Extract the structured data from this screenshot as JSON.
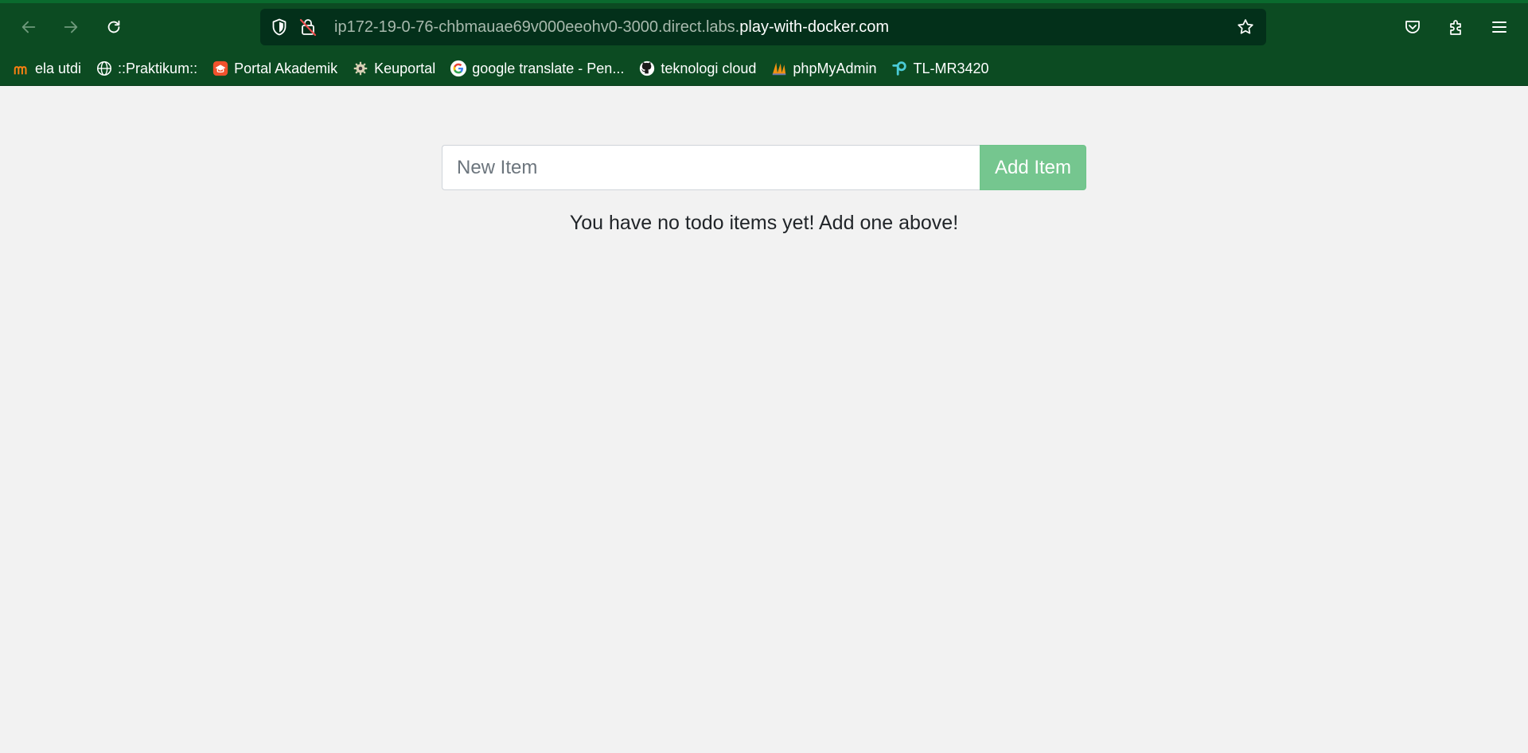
{
  "browser": {
    "url_prefix": "ip172-19-0-76-chbmauae69v000eeohv0-3000.direct.labs.",
    "url_host": "play-with-docker.com",
    "colors": {
      "chrome": "#0c4b22",
      "urlbar": "#03301a"
    },
    "icons": {
      "back": "back-arrow-icon",
      "forward": "forward-arrow-icon",
      "reload": "reload-icon",
      "shield": "tracking-shield-icon",
      "insecure": "insecure-lock-icon",
      "bookmark_star": "star-icon",
      "pocket": "pocket-icon",
      "extensions": "extensions-icon",
      "menu": "hamburger-menu-icon"
    }
  },
  "bookmarks": [
    {
      "label": "ela utdi",
      "icon": "moodle-icon"
    },
    {
      "label": "::Praktikum::",
      "icon": "globe-icon"
    },
    {
      "label": "Portal Akademik",
      "icon": "portal-icon"
    },
    {
      "label": "Keuportal",
      "icon": "gear-icon"
    },
    {
      "label": "google translate - Pen...",
      "icon": "google-icon"
    },
    {
      "label": "teknologi cloud",
      "icon": "github-icon"
    },
    {
      "label": "phpMyAdmin",
      "icon": "phpmyadmin-icon"
    },
    {
      "label": "TL-MR3420",
      "icon": "tplink-icon"
    }
  ],
  "app": {
    "new_item_placeholder": "New Item",
    "add_button_label": "Add Item",
    "empty_message": "You have no todo items yet! Add one above!",
    "colors": {
      "add_button": "#75c68f",
      "background": "#f2f2f2"
    }
  }
}
